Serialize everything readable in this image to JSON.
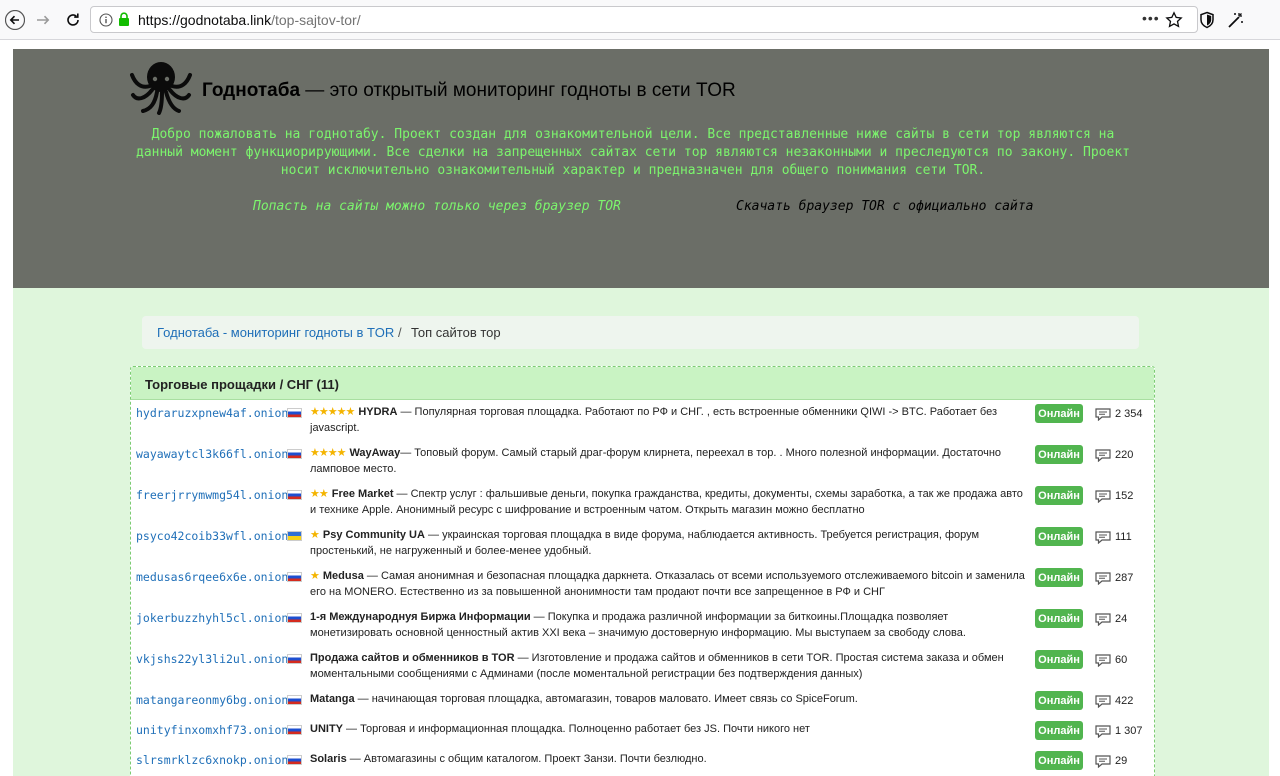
{
  "browser": {
    "url_domain": "https://godnotaba.link",
    "url_path": "/top-sajtov-tor/",
    "more_label": "•••"
  },
  "header": {
    "title_bold": "Годнотаба",
    "title_rest": " — это открытый мониторинг годноты в сети TOR",
    "welcome": "Добро пожаловать на годнотабу. Проект создан для ознакомительной цели. Все представленные ниже сайты в сети тор являются на данный момент функциорирующими. Все сделки на запрещенных сайтах сети тор являются незаконными и преследуются по закону. Проект носит исключительно ознакомительный характер и предназначен для общего понимания сети TOR.",
    "tor_link": "Попасть на сайты можно только через браузер TOR",
    "download_link": "Скачать браузер TOR с официально  сайта"
  },
  "breadcrumb": {
    "home": "Годнотаба - мониторинг годноты в TOR",
    "separator": "/",
    "current": "Топ сайтов тор"
  },
  "panel": {
    "title": "Торговые прощадки / СНГ (11)",
    "status_label": "Онлайн",
    "rows": [
      {
        "onion": "hydraruzxpnew4af.onion",
        "flag": "ru",
        "stars": "★★★★★",
        "name": "HYDRA",
        "text": " — Популярная торговая площадка. Работают по РФ и СНГ. , есть встроенные обменники QIWI -> BTC. Работает без javascript.",
        "count": "2 354"
      },
      {
        "onion": "wayawaytcl3k66fl.onion",
        "flag": "ru",
        "stars": "★★★★",
        "name": "WayAway",
        "text": "— Топовый форум. Самый старый драг-форум клирнета, переехал в тор. . Много полезной информации. Достаточно ламповое место.",
        "count": "220"
      },
      {
        "onion": "freerjrrymwmg54l.onion",
        "flag": "ru",
        "stars": "★★",
        "name": "Free Market",
        "text": " — Спектр услуг : фальшивые деньги, покупка гражданства, кредиты, документы, схемы заработка, а так же продажа авто и технике Apple. Анонимный ресурс с шифрование и встроенным чатом. Открыть магазин можно бесплатно",
        "count": "152"
      },
      {
        "onion": "psyco42coib33wfl.onion",
        "flag": "ua",
        "stars": "★",
        "name": "Psy Community UA",
        "text": " — украинская торговая площадка в виде форума, наблюдается активность. Требуется регистрация, форум простенький, не нагруженный и более-менее удобный.",
        "count": "111"
      },
      {
        "onion": "medusas6rqee6x6e.onion",
        "flag": "ru",
        "stars": "★",
        "name": "Medusa",
        "text": " — Самая анонимная и безопасная площадка даркнета. Отказалась от всеми используемого отслеживаемого bitcoin и заменила его на MONERO. Естественно из за повышенной анонимности там продают почти все запрещенное в РФ и СНГ",
        "count": "287"
      },
      {
        "onion": "jokerbuzzhyhl5cl.onion",
        "flag": "ru",
        "stars": "",
        "name": "1-я Международнуя Биржа Информации",
        "text": " — Покупка и продажа различной информации за биткоины.Площадка позволяет монетизировать основной ценностный актив XXI века – значимую достоверную информацию. Мы выступаем за свободу слова.",
        "count": "24"
      },
      {
        "onion": "vkjshs22yl3li2ul.onion",
        "flag": "ru",
        "stars": "",
        "name": "Продажа сайтов и обменников в TOR",
        "text": " — Изготовление и продажа сайтов и обменников в сети TOR. Простая система заказа и обмен моментальными сообщениями с Админами (после моментальной регистрации без подтверждения данных)",
        "count": "60"
      },
      {
        "onion": "matangareonmy6bg.onion",
        "flag": "ru",
        "stars": "",
        "name": "Matanga",
        "text": " — начинающая торговая площадка, автомагазин, товаров маловато. Имеет связь со SpiceForum.",
        "count": "422"
      },
      {
        "onion": "unityfinxomxhf73.onion",
        "flag": "ru",
        "stars": "",
        "name": "UNITY",
        "text": " — Торговая и информационная площадка. Полноценно работает без JS. Почти никого нет",
        "count": "1 307"
      },
      {
        "onion": "slrsmrklzc6xnokp.onion",
        "flag": "ru",
        "stars": "",
        "name": "Solaris",
        "text": " — Автомагазины с общим каталогом. Проект Занзи. Почти безлюдно.",
        "count": "29"
      }
    ]
  },
  "icons": {
    "back": "back-arrow-icon",
    "forward": "forward-arrow-icon",
    "reload": "reload-icon",
    "info": "info-icon",
    "lock": "lock-icon",
    "star": "bookmark-star-icon",
    "shield": "shield-icon",
    "extension": "extension-icon",
    "comment": "comment-icon",
    "logo": "octopus-logo"
  },
  "colors": {
    "header_bg": "#6b6e67",
    "page_bg": "#dff6dc",
    "accent_green_text": "#7cf56d",
    "status_green": "#51b54f",
    "link_blue": "#1f6fb8",
    "stars": "#f4b400"
  }
}
